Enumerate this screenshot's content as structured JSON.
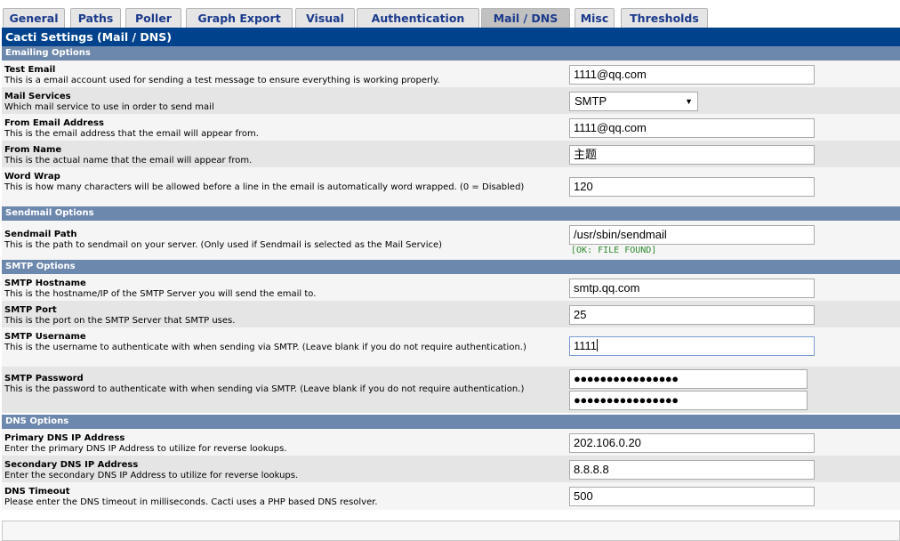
{
  "tabs": [
    {
      "label": "General"
    },
    {
      "label": "Paths"
    },
    {
      "label": "Poller"
    },
    {
      "label": "Graph Export"
    },
    {
      "label": "Visual"
    },
    {
      "label": "Authentication"
    },
    {
      "label": "Mail / DNS"
    },
    {
      "label": "Misc"
    },
    {
      "label": "Thresholds"
    }
  ],
  "active_tab": "Mail / DNS",
  "page_title": "Cacti Settings (Mail / DNS)",
  "sections": {
    "emailing": "Emailing Options",
    "sendmail": "Sendmail Options",
    "smtp": "SMTP Options",
    "dns": "DNS Options"
  },
  "fields": {
    "test_email": {
      "title": "Test Email",
      "desc": "This is a email account used for sending a test message to ensure everything is working properly.",
      "value": "1111@qq.com"
    },
    "mail_services": {
      "title": "Mail Services",
      "desc": "Which mail service to use in order to send mail",
      "value": "SMTP"
    },
    "from_email": {
      "title": "From Email Address",
      "desc": "This is the email address that the email will appear from.",
      "value": "1111@qq.com"
    },
    "from_name": {
      "title": "From Name",
      "desc": "This is the actual name that the email will appear from.",
      "value": "主题"
    },
    "word_wrap": {
      "title": "Word Wrap",
      "desc": "This is how many characters will be allowed before a line in the email is automatically word wrapped. (0 = Disabled)",
      "value": "120"
    },
    "sendmail_path": {
      "title": "Sendmail Path",
      "desc": "This is the path to sendmail on your server. (Only used if Sendmail is selected as the Mail Service)",
      "value": "/usr/sbin/sendmail",
      "status": "[OK: FILE FOUND]"
    },
    "smtp_host": {
      "title": "SMTP Hostname",
      "desc": "This is the hostname/IP of the SMTP Server you will send the email to.",
      "value": "smtp.qq.com"
    },
    "smtp_port": {
      "title": "SMTP Port",
      "desc": "This is the port on the SMTP Server that SMTP uses.",
      "value": "25"
    },
    "smtp_user": {
      "title": "SMTP Username",
      "desc": "This is the username to authenticate with when sending via SMTP. (Leave blank if you do not require authentication.)",
      "value": "1111"
    },
    "smtp_pass": {
      "title": "SMTP Password",
      "desc": "This is the password to authenticate with when sending via SMTP. (Leave blank if you do not require authentication.)",
      "value": "●●●●●●●●●●●●●●●●",
      "confirm": "●●●●●●●●●●●●●●●●"
    },
    "dns_primary": {
      "title": "Primary DNS IP Address",
      "desc": "Enter the primary DNS IP Address to utilize for reverse lookups.",
      "value": "202.106.0.20"
    },
    "dns_secondary": {
      "title": "Secondary DNS IP Address",
      "desc": "Enter the secondary DNS IP Address to utilize for reverse lookups.",
      "value": "8.8.8.8"
    },
    "dns_timeout": {
      "title": "DNS Timeout",
      "desc": "Please enter the DNS timeout in milliseconds. Cacti uses a PHP based DNS resolver.",
      "value": "500"
    }
  },
  "colors": {
    "title_bar": "#00438c",
    "section_bar": "#6d88ad",
    "tab_text": "#1b3a8c",
    "ok_text": "#2e8b2e"
  }
}
